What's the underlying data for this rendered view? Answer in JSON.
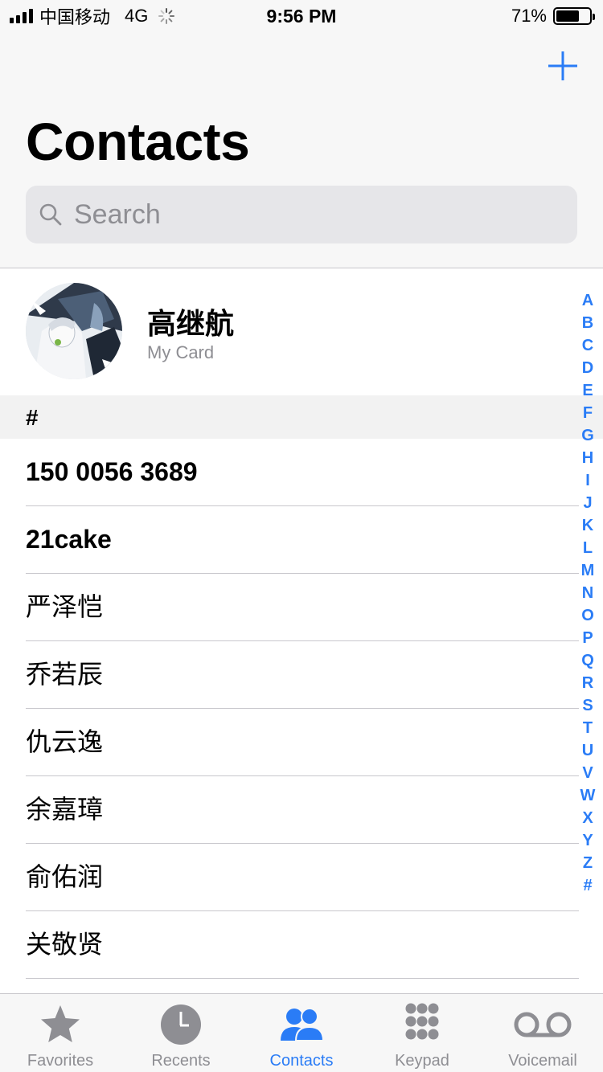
{
  "status_bar": {
    "carrier": "中国移动",
    "network": "4G",
    "time": "9:56 PM",
    "battery_percent": "71%",
    "battery_level": 0.71
  },
  "header": {
    "title": "Contacts",
    "add_icon": "plus-icon",
    "search_placeholder": "Search"
  },
  "my_card": {
    "name": "高继航",
    "subtitle": "My Card"
  },
  "section": {
    "header": "#"
  },
  "contacts": [
    "150 0056 3689",
    "21cake",
    "严泽恺",
    "乔若辰",
    "仇云逸",
    "余嘉璋",
    "俞佑润",
    "关敬贤"
  ],
  "index_letters": [
    "A",
    "B",
    "C",
    "D",
    "E",
    "F",
    "G",
    "H",
    "I",
    "J",
    "K",
    "L",
    "M",
    "N",
    "O",
    "P",
    "Q",
    "R",
    "S",
    "T",
    "U",
    "V",
    "W",
    "X",
    "Y",
    "Z",
    "#"
  ],
  "tabs": [
    {
      "label": "Favorites",
      "icon": "star-icon"
    },
    {
      "label": "Recents",
      "icon": "clock-icon"
    },
    {
      "label": "Contacts",
      "icon": "contacts-icon"
    },
    {
      "label": "Keypad",
      "icon": "keypad-icon"
    },
    {
      "label": "Voicemail",
      "icon": "voicemail-icon"
    }
  ],
  "colors": {
    "accent": "#2a7cf6",
    "inactive": "#8e8e93"
  }
}
